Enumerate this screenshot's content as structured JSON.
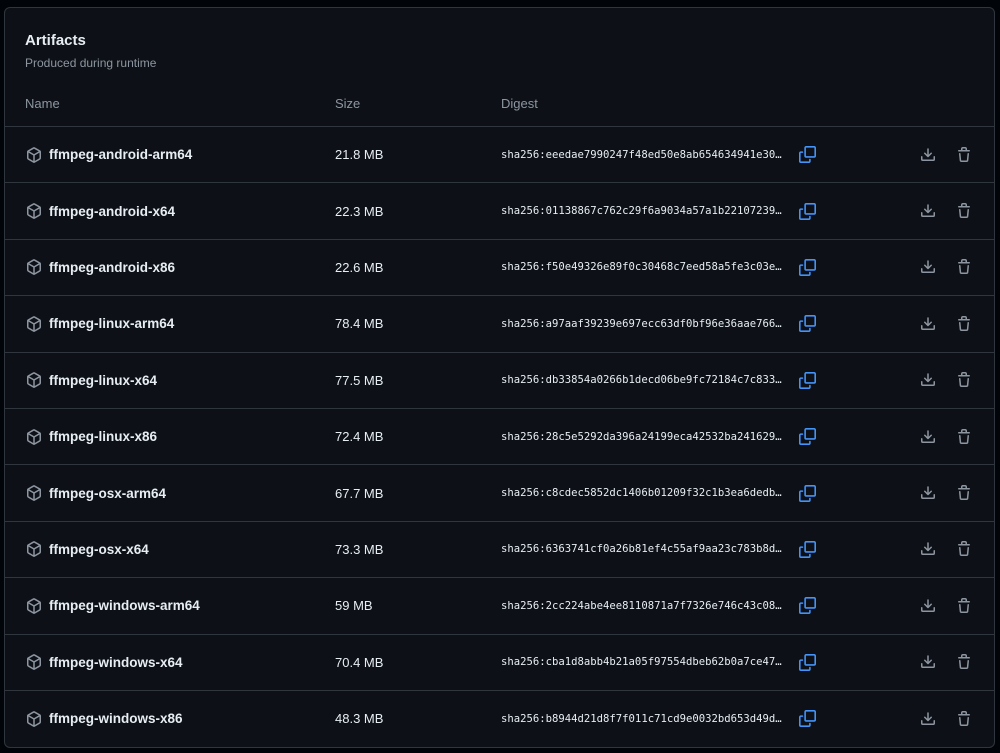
{
  "header": {
    "title": "Artifacts",
    "subtitle": "Produced during runtime"
  },
  "columns": {
    "name": "Name",
    "size": "Size",
    "digest": "Digest"
  },
  "icons": {
    "package": "package-icon",
    "copy": "copy-icon",
    "download": "download-icon",
    "trash": "trash-icon"
  },
  "colors": {
    "accent": "#4493f8",
    "muted": "#8d96a0",
    "border": "#30363d",
    "background": "#0d1117"
  },
  "artifacts": [
    {
      "name": "ffmpeg-android-arm64",
      "size": "21.8 MB",
      "digest": "sha256:eeedae7990247f48ed50e8ab654634941e30…"
    },
    {
      "name": "ffmpeg-android-x64",
      "size": "22.3 MB",
      "digest": "sha256:01138867c762c29f6a9034a57a1b22107239…"
    },
    {
      "name": "ffmpeg-android-x86",
      "size": "22.6 MB",
      "digest": "sha256:f50e49326e89f0c30468c7eed58a5fe3c03e…"
    },
    {
      "name": "ffmpeg-linux-arm64",
      "size": "78.4 MB",
      "digest": "sha256:a97aaf39239e697ecc63df0bf96e36aae766…"
    },
    {
      "name": "ffmpeg-linux-x64",
      "size": "77.5 MB",
      "digest": "sha256:db33854a0266b1decd06be9fc72184c7c833…"
    },
    {
      "name": "ffmpeg-linux-x86",
      "size": "72.4 MB",
      "digest": "sha256:28c5e5292da396a24199eca42532ba241629…"
    },
    {
      "name": "ffmpeg-osx-arm64",
      "size": "67.7 MB",
      "digest": "sha256:c8cdec5852dc1406b01209f32c1b3ea6dedb…"
    },
    {
      "name": "ffmpeg-osx-x64",
      "size": "73.3 MB",
      "digest": "sha256:6363741cf0a26b81ef4c55af9aa23c783b8d…"
    },
    {
      "name": "ffmpeg-windows-arm64",
      "size": "59 MB",
      "digest": "sha256:2cc224abe4ee8110871a7f7326e746c43c08…"
    },
    {
      "name": "ffmpeg-windows-x64",
      "size": "70.4 MB",
      "digest": "sha256:cba1d8abb4b21a05f97554dbeb62b0a7ce47…"
    },
    {
      "name": "ffmpeg-windows-x86",
      "size": "48.3 MB",
      "digest": "sha256:b8944d21d8f7f011c71cd9e0032bd653d49d…"
    }
  ]
}
